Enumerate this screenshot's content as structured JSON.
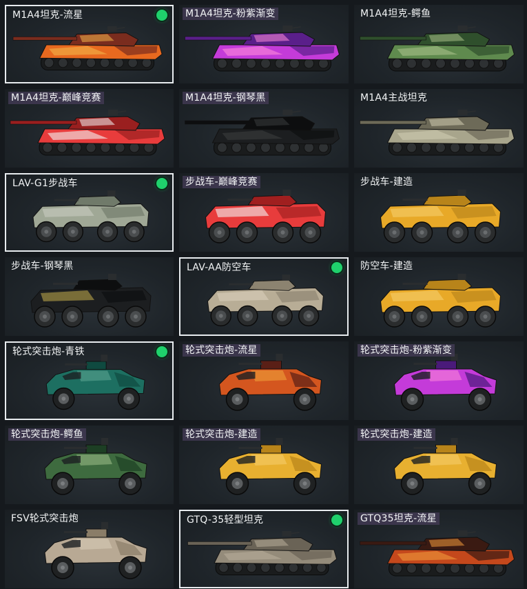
{
  "cards": [
    {
      "label": "M1A4坦克-流星",
      "type": "tank",
      "colors": [
        "#7a2c1e",
        "#e8691f",
        "#f2b44a"
      ],
      "owned": true,
      "selected": true
    },
    {
      "label": "M1A4坦克-粉紫渐变",
      "type": "tank",
      "colors": [
        "#5a1f8a",
        "#c43bd9",
        "#ff8ad8"
      ],
      "owned": false,
      "selected": false
    },
    {
      "label": "M1A4坦克-鳄鱼",
      "type": "tank",
      "colors": [
        "#2f4f2c",
        "#5f8a4e",
        "#a7c089"
      ],
      "owned": false,
      "selected": false
    },
    {
      "label": "M1A4坦克-巅峰竞赛",
      "type": "tank",
      "colors": [
        "#9a1f1f",
        "#e83c3c",
        "#f2f2f2"
      ],
      "owned": false,
      "selected": false
    },
    {
      "label": "M1A4坦克-钢琴黑",
      "type": "tank",
      "colors": [
        "#0d0e0f",
        "#1c1e20",
        "#3a3c3e"
      ],
      "owned": false,
      "selected": false
    },
    {
      "label": "M1A4主战坦克",
      "type": "tank",
      "colors": [
        "#6d6a58",
        "#a8a58c",
        "#cfcbb0"
      ],
      "owned": false,
      "selected": false
    },
    {
      "label": "LAV-G1步战车",
      "type": "ifv",
      "colors": [
        "#707a6a",
        "#a0a896",
        "#c8ccc0"
      ],
      "owned": true,
      "selected": true
    },
    {
      "label": "步战车-巅峰竞赛",
      "type": "ifv",
      "colors": [
        "#a01f1f",
        "#e83c3c",
        "#f2f2f2"
      ],
      "owned": false,
      "selected": false
    },
    {
      "label": "步战车-建造",
      "type": "ifv",
      "colors": [
        "#b8841a",
        "#e8a928",
        "#f5cf6a"
      ],
      "owned": false,
      "selected": false
    },
    {
      "label": "步战车-钢琴黑",
      "type": "ifv",
      "colors": [
        "#0d0e0f",
        "#1c1e20",
        "#b8a24a"
      ],
      "owned": false,
      "selected": false
    },
    {
      "label": "LAV-AA防空车",
      "type": "ifv",
      "colors": [
        "#8c8370",
        "#b8ad96",
        "#d8cfba"
      ],
      "owned": true,
      "selected": true
    },
    {
      "label": "防空车-建造",
      "type": "ifv",
      "colors": [
        "#b8841a",
        "#e8a928",
        "#f5cf6a"
      ],
      "owned": false,
      "selected": false
    },
    {
      "label": "轮式突击炮-青铁",
      "type": "buggy",
      "colors": [
        "#0f4a40",
        "#1d6f61",
        "#5fa896"
      ],
      "owned": true,
      "selected": true
    },
    {
      "label": "轮式突击炮-流星",
      "type": "buggy",
      "colors": [
        "#5a1f16",
        "#d4561f",
        "#f0a83a"
      ],
      "owned": false,
      "selected": false
    },
    {
      "label": "轮式突击炮-粉紫渐变",
      "type": "buggy",
      "colors": [
        "#4a1a7a",
        "#c43bd9",
        "#ff8ad8"
      ],
      "owned": false,
      "selected": false
    },
    {
      "label": "轮式突击炮-鳄鱼",
      "type": "buggy",
      "colors": [
        "#1d3f24",
        "#3e6b3f",
        "#9fc08a"
      ],
      "owned": false,
      "selected": false
    },
    {
      "label": "轮式突击炮-建造",
      "type": "buggy",
      "colors": [
        "#b8841a",
        "#e8b030",
        "#f5d070"
      ],
      "owned": false,
      "selected": false
    },
    {
      "label": "轮式突击炮-建造",
      "type": "buggy",
      "colors": [
        "#b8841a",
        "#e8b030",
        "#f5d070"
      ],
      "owned": false,
      "selected": false
    },
    {
      "label": "FSV轮式突击炮",
      "type": "buggy",
      "colors": [
        "#8a7d68",
        "#b8a994",
        "#d8cdb8"
      ],
      "owned": false,
      "selected": false
    },
    {
      "label": "GTQ-35轻型坦克",
      "type": "tank",
      "colors": [
        "#6a6356",
        "#948b7a",
        "#b8ae9a"
      ],
      "owned": true,
      "selected": true
    },
    {
      "label": "GTQ35坦克-流星",
      "type": "tank",
      "colors": [
        "#3a1a12",
        "#c4481c",
        "#f09a3a"
      ],
      "owned": false,
      "selected": false
    }
  ],
  "skin_label_indices": [
    1,
    3,
    4,
    7,
    13,
    14,
    15,
    16,
    17,
    20
  ]
}
